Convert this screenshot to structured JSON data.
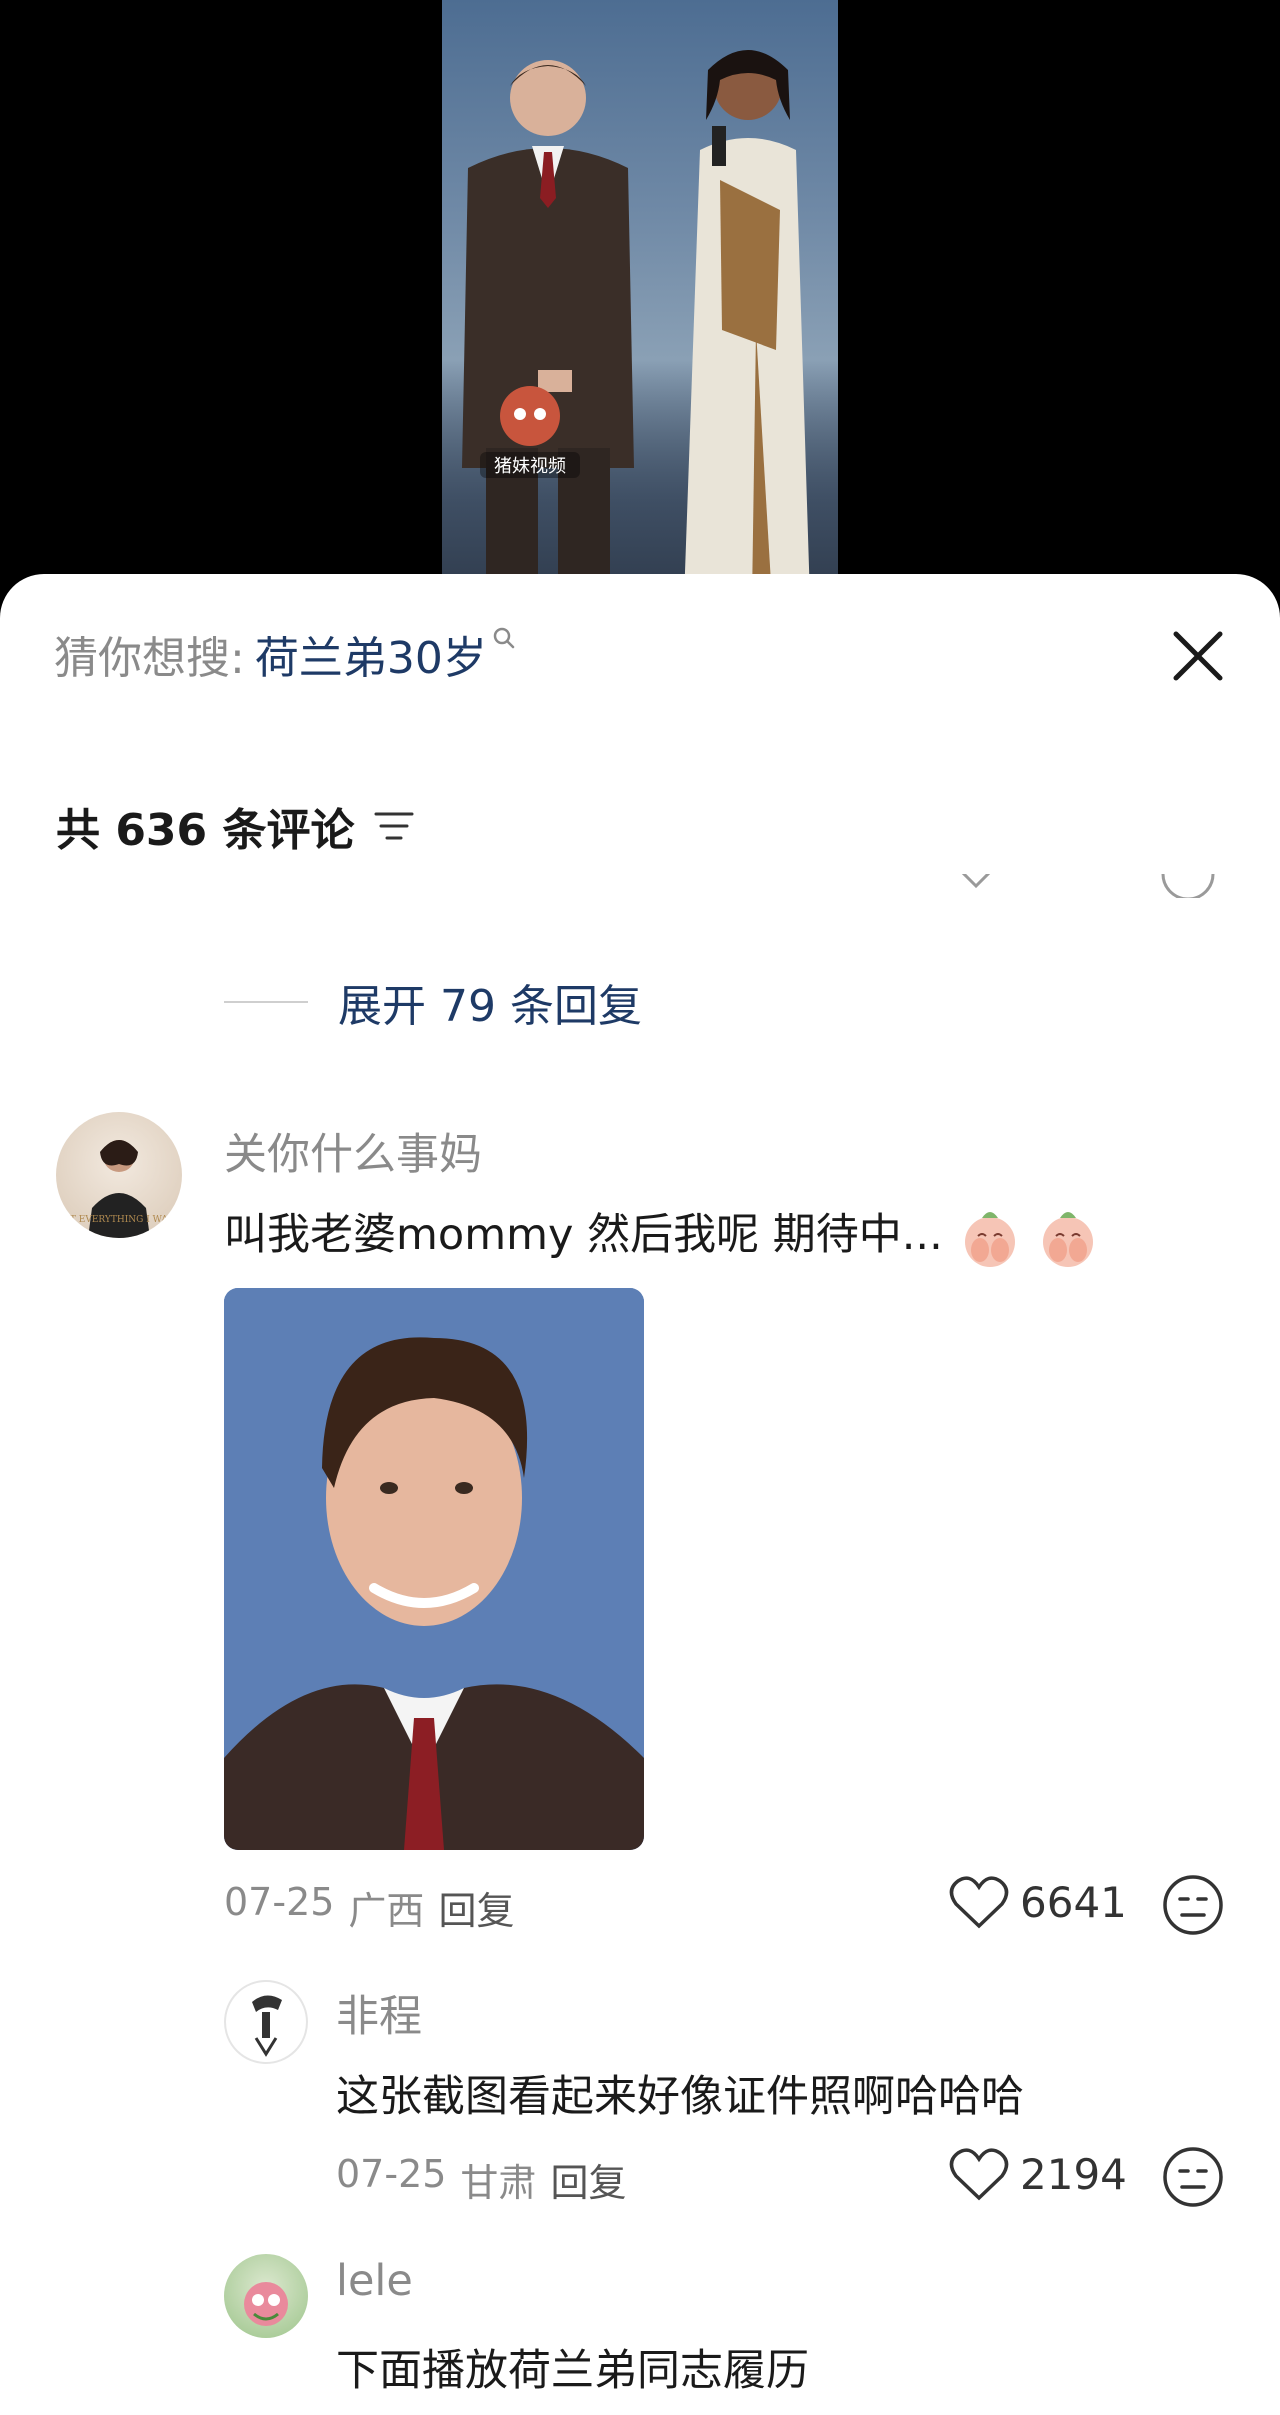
{
  "video": {
    "watermark": "猪妹视频"
  },
  "search_suggestion": {
    "prefix": "猜你想搜:",
    "keyword": "荷兰弟30岁"
  },
  "comments_header": {
    "count_label": "共 636 条评论"
  },
  "expand_replies": {
    "label": "展开 79 条回复"
  },
  "comments": [
    {
      "username": "关你什么事妈",
      "text": "叫我老婆mommy 然后我呢 期待中...",
      "emojis": [
        "hands-over-mouth-emoji",
        "hands-over-mouth-emoji"
      ],
      "date": "07-25",
      "location": "广西",
      "reply_label": "回复",
      "likes": "6641",
      "avatar_text": "GET EVERYTHING I WANT"
    }
  ],
  "replies": [
    {
      "username": "非程",
      "text": "这张截图看起来好像证件照啊哈哈哈",
      "date": "07-25",
      "location": "甘肃",
      "reply_label": "回复",
      "likes": "2194"
    },
    {
      "username": "lele",
      "text": "下面播放荷兰弟同志履历"
    }
  ],
  "icons": {
    "close": "close-icon",
    "sort": "sort-icon",
    "like": "heart-icon",
    "dislike": "meh-face-icon",
    "search": "search-icon"
  },
  "colors": {
    "link_blue": "#1e3a66",
    "muted_gray": "#8a8a8a",
    "panel_bg": "#ffffff",
    "video_bg": "#000000"
  }
}
